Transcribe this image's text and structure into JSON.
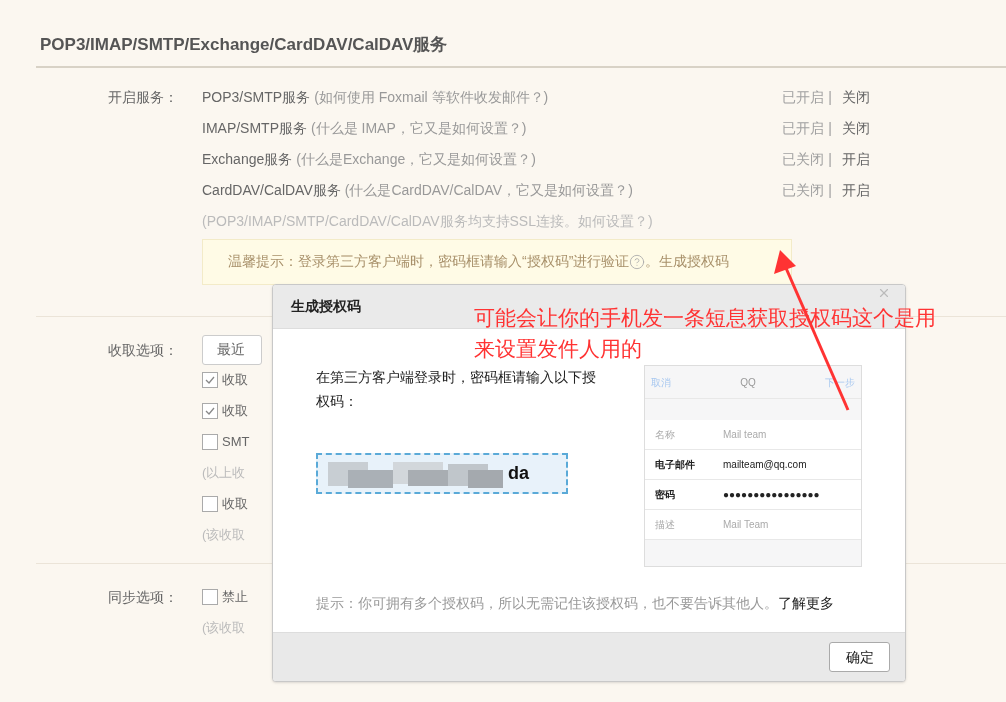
{
  "section_title": "POP3/IMAP/SMTP/Exchange/CardDAV/CalDAV服务",
  "services": {
    "label": "开启服务：",
    "items": [
      {
        "name": "POP3/SMTP服务",
        "help": "(如何使用 Foxmail 等软件收发邮件？)",
        "status": "已开启",
        "separator": "|",
        "action": "关闭"
      },
      {
        "name": "IMAP/SMTP服务",
        "help": "(什么是 IMAP，它又是如何设置？)",
        "status": "已开启",
        "separator": "|",
        "action": "关闭"
      },
      {
        "name": "Exchange服务",
        "help": "(什么是Exchange，它又是如何设置？)",
        "status": "已关闭",
        "separator": "|",
        "action": "开启"
      },
      {
        "name": "CardDAV/CalDAV服务",
        "help": "(什么是CardDAV/CalDAV，它又是如何设置？)",
        "status": "已关闭",
        "separator": "|",
        "action": "开启"
      }
    ],
    "ssl_note": "(POP3/IMAP/SMTP/CardDAV/CalDAV服务均支持SSL连接。",
    "ssl_link": "如何设置？)"
  },
  "tip": {
    "text": "温馨提示：登录第三方客户端时，密码框请输入“授权码”进行验证",
    "suffix": "。",
    "link": "生成授权码"
  },
  "fetch": {
    "label": "收取选项：",
    "select": "最近",
    "options": [
      {
        "kind": "checkbox",
        "label": "收取",
        "checked": true
      },
      {
        "kind": "checkbox",
        "label": "收取",
        "checked": true
      },
      {
        "kind": "checkbox",
        "label": "SMT",
        "checked": false
      },
      {
        "kind": "note",
        "label": "(以上收"
      },
      {
        "kind": "checkbox",
        "label": "收取",
        "checked": false
      },
      {
        "kind": "note",
        "label": "(该收取"
      }
    ]
  },
  "sync": {
    "label": "同步选项：",
    "options": [
      {
        "kind": "checkbox",
        "label": "禁止",
        "checked": false
      },
      {
        "kind": "note",
        "label": "(该收取"
      }
    ]
  },
  "dialog": {
    "title": "生成授权码",
    "instruction": "在第三方客户端登录时，密码框请输入以下授权码：",
    "code_visible": "da",
    "hint": "提示：你可拥有多个授权码，所以无需记住该授权码，也不要告诉其他人。",
    "learn_more": "了解更多",
    "confirm": "确定",
    "phone": {
      "cancel": "取消",
      "title": "QQ",
      "next": "下一步",
      "fields": [
        {
          "label": "名称",
          "value": "Mail team",
          "strong": false
        },
        {
          "label": "电子邮件",
          "value": "mailteam@qq.com",
          "strong": true
        },
        {
          "label": "密码",
          "value": "●●●●●●●●●●●●●●●●",
          "strong": true
        },
        {
          "label": "描述",
          "value": "Mail Team",
          "strong": false
        }
      ]
    }
  },
  "annotation": {
    "lines": [
      "可能会让你的手机发一条短息获取授权码这个是用",
      "来设置发件人用的"
    ]
  }
}
